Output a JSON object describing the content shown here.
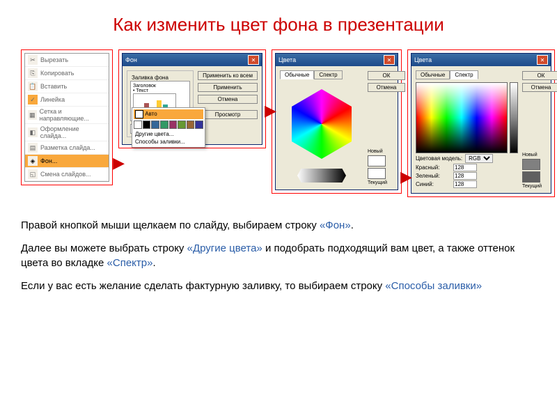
{
  "title": "Как изменить цвет фона в презентации",
  "context_menu": {
    "items": [
      {
        "label": "Вырезать",
        "icon": "✂"
      },
      {
        "label": "Копировать",
        "icon": "⎘"
      },
      {
        "label": "Вставить",
        "icon": "📋"
      },
      {
        "label": "Линейка",
        "icon": "📏",
        "checked": true
      },
      {
        "label": "Сетка и направляющие...",
        "icon": "▦"
      },
      {
        "label": "Оформление слайда...",
        "icon": "◧"
      },
      {
        "label": "Разметка слайда...",
        "icon": "▤"
      },
      {
        "label": "Фон...",
        "icon": "◈",
        "highlighted": true
      },
      {
        "label": "Смена слайдов...",
        "icon": "◱"
      }
    ]
  },
  "bg_dialog": {
    "title": "Фон",
    "group": "Заливка фона",
    "preview_title": "Заголовок",
    "preview_text": "• Текст",
    "buttons": {
      "apply_all": "Применить ко всем",
      "apply": "Применить",
      "cancel": "Отмена",
      "preview": "Просмотр"
    },
    "dropdown": {
      "auto": "Авто",
      "more": "Другие цвета...",
      "fill": "Способы заливки..."
    }
  },
  "color_std": {
    "title": "Цвета",
    "tabs": {
      "std": "Обычные",
      "spec": "Спектр"
    },
    "ok": "ОК",
    "cancel": "Отмена",
    "new": "Новый",
    "current": "Текущий"
  },
  "color_spec": {
    "title": "Цвета",
    "tabs": {
      "std": "Обычные",
      "spec": "Спектр"
    },
    "ok": "ОК",
    "cancel": "Отмена",
    "model_label": "Цветовая модель:",
    "model": "RGB",
    "r_label": "Красный:",
    "g_label": "Зеленый:",
    "b_label": "Синий:",
    "r": "128",
    "g": "128",
    "b": "128",
    "new": "Новый",
    "current": "Текущий"
  },
  "desc": {
    "p1a": "Правой кнопкой мыши щелкаем по слайду, выбираем строку ",
    "p1q": "«Фон»",
    "p1b": ".",
    "p2a": "Далее вы можете выбрать строку ",
    "p2q": "«Другие цвета»",
    "p2b": " и подобрать подходящий вам цвет, а также оттенок цвета во вкладке ",
    "p2q2": "«Спектр»",
    "p2c": ".",
    "p3a": "Если у вас есть желание сделать фактурную заливку, то выбираем строку ",
    "p3q": "«Способы заливки»"
  }
}
